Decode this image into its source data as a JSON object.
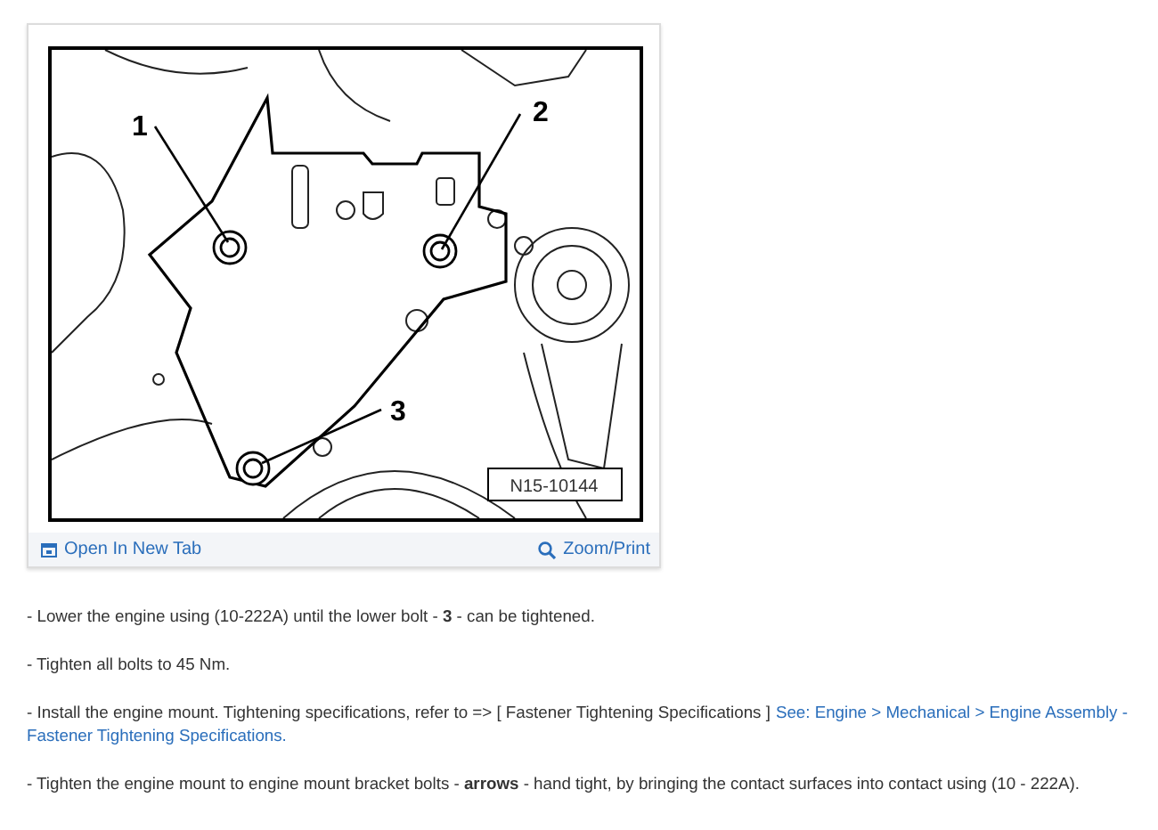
{
  "figure": {
    "callouts": [
      "1",
      "2",
      "3"
    ],
    "figure_id": "N15-10144",
    "open_link": "Open In New Tab",
    "zoom_link": "Zoom/Print"
  },
  "steps": [
    {
      "text": "-  Lower the engine using (10-222A) until the lower bolt - **3** - can be tightened."
    },
    {
      "text": "-  Tighten all bolts to 45 Nm."
    },
    {
      "text": "-  Install the engine mount. Tightening specifications, refer to => [ Fastener Tightening Specifications ]",
      "link_lines": [
        "See: Engine > Mechanical > Engine Assembly -",
        "Fastener Tightening Specifications."
      ]
    },
    {
      "text": "-  Tighten the engine mount to engine mount bracket bolts - **arrows** - hand tight, by bringing the contact surfaces into contact using (10 - 222A)."
    }
  ]
}
